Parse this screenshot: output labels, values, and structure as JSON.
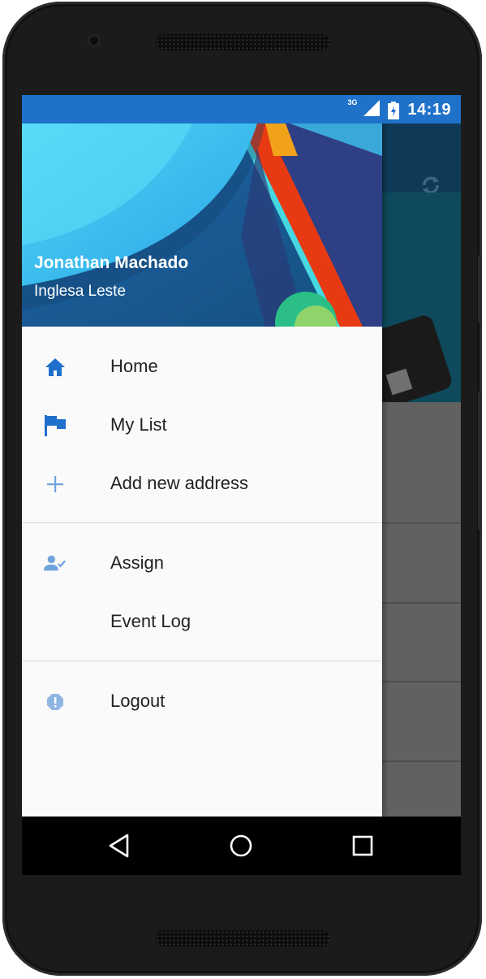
{
  "status_bar": {
    "network": "3G",
    "time": "14:19"
  },
  "drawer": {
    "header": {
      "name": "Jonathan Machado",
      "subtitle": "Inglesa Leste"
    },
    "sections": [
      [
        {
          "label": "Home",
          "icon": "home-icon"
        },
        {
          "label": "My List",
          "icon": "flag-icon"
        },
        {
          "label": "Add new address",
          "icon": "plus-icon"
        }
      ],
      [
        {
          "label": "Assign",
          "icon": "person-check-icon"
        },
        {
          "label": "Event Log",
          "icon": ""
        }
      ],
      [
        {
          "label": "Logout",
          "icon": "alert-octagon-icon"
        }
      ]
    ]
  },
  "colors": {
    "status_bar": "#1f71c9",
    "icon_blue": "#1f6fcc",
    "icon_light_blue": "#6fa3dc",
    "drawer_bg": "#fafafa"
  },
  "system_nav": {
    "buttons": [
      "back-icon",
      "home-circle-icon",
      "recents-icon"
    ]
  }
}
